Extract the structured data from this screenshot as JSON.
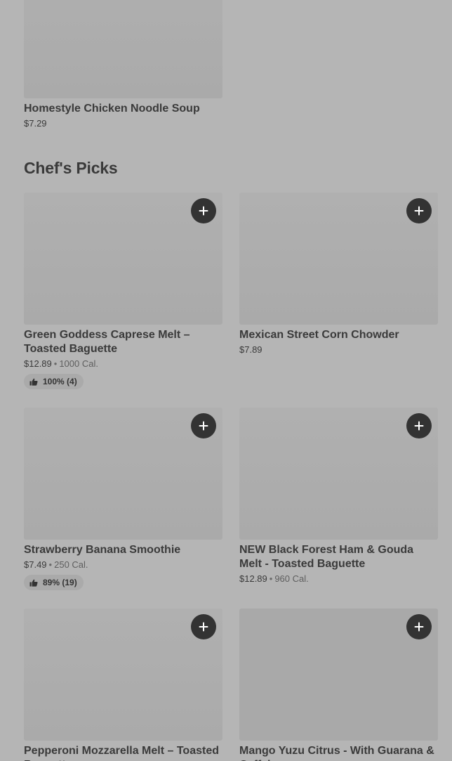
{
  "top_item": {
    "name": "Homestyle Chicken Noodle Soup",
    "price": "$7.29"
  },
  "section": {
    "title": "Chef's Picks"
  },
  "items": [
    {
      "name": "Green Goddess Caprese Melt – Toasted Baguette",
      "price": "$12.89",
      "calories": "1000 Cal.",
      "rating": "100% (4)"
    },
    {
      "name": "Mexican Street Corn Chowder",
      "price": "$7.89"
    },
    {
      "name": "Strawberry Banana Smoothie",
      "price": "$7.49",
      "calories": "250 Cal.",
      "rating": "89% (19)"
    },
    {
      "name": "NEW Black Forest Ham & Gouda Melt - Toasted Baguette",
      "price": "$12.89",
      "calories": "960 Cal."
    },
    {
      "name": "Pepperoni Mozzarella Melt – Toasted Baguette",
      "price": ""
    },
    {
      "name": "Mango Yuzu Citrus - With Guarana & Caffeine",
      "price": ""
    }
  ],
  "meta_separator": "•",
  "icons": {
    "add": "plus-icon",
    "rating": "thumbs-up-icon"
  },
  "colors": {
    "background": "#b5b5b5",
    "button": "#333333",
    "button_icon": "#ffffff"
  }
}
